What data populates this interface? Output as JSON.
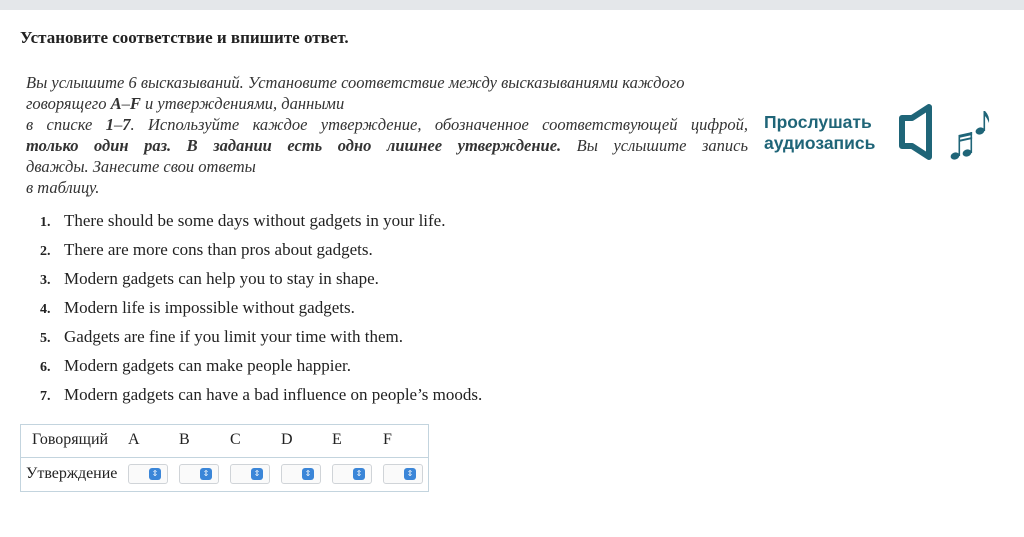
{
  "heading": "Установите соответствие и впишите ответ.",
  "instruction": {
    "line1": "Вы услышите 6 высказываний. Установите соответствие между высказываниями каждого",
    "line2_a": "говорящего ",
    "line2_b": "A",
    "line2_c": "–",
    "line2_d": "F",
    "line2_e": " и утверждениями, данными",
    "line3_a": "в списке ",
    "line3_b": "1",
    "line3_c": "–",
    "line3_d": "7",
    "line3_e": ". Используйте каждое утверждение, обозначенное соответствующей цифрой,",
    "line4_bold": "только один раз. В задании есть одно лишнее утверждение.",
    "line4_rest": " Вы услышите запись",
    "line5": "дважды. Занесите свои ответы",
    "line6": "в таблицу."
  },
  "audio": {
    "label_line1": "Прослушать",
    "label_line2": "аудиозапись",
    "icon": "speaker-music-icon",
    "color": "#1f6578"
  },
  "statements": [
    {
      "num": "1.",
      "text": "There should be some days without gadgets in your life."
    },
    {
      "num": "2.",
      "text": "There are more cons than pros about gadgets."
    },
    {
      "num": "3.",
      "text": "Modern gadgets can help you to stay in shape."
    },
    {
      "num": "4.",
      "text": "Modern life is impossible without gadgets."
    },
    {
      "num": "5.",
      "text": "Gadgets are fine if you limit your time with them."
    },
    {
      "num": "6.",
      "text": "Modern gadgets can make people happier."
    },
    {
      "num": "7.",
      "text": "Modern gadgets can have a bad influence on people’s moods."
    }
  ],
  "answer_table": {
    "speaker_label": "Говорящий",
    "statement_label": "Утверждение",
    "speakers": [
      "A",
      "B",
      "C",
      "D",
      "E",
      "F"
    ],
    "selected_values": [
      "",
      "",
      "",
      "",
      "",
      ""
    ],
    "select_icon": "updown-chevron-icon"
  }
}
